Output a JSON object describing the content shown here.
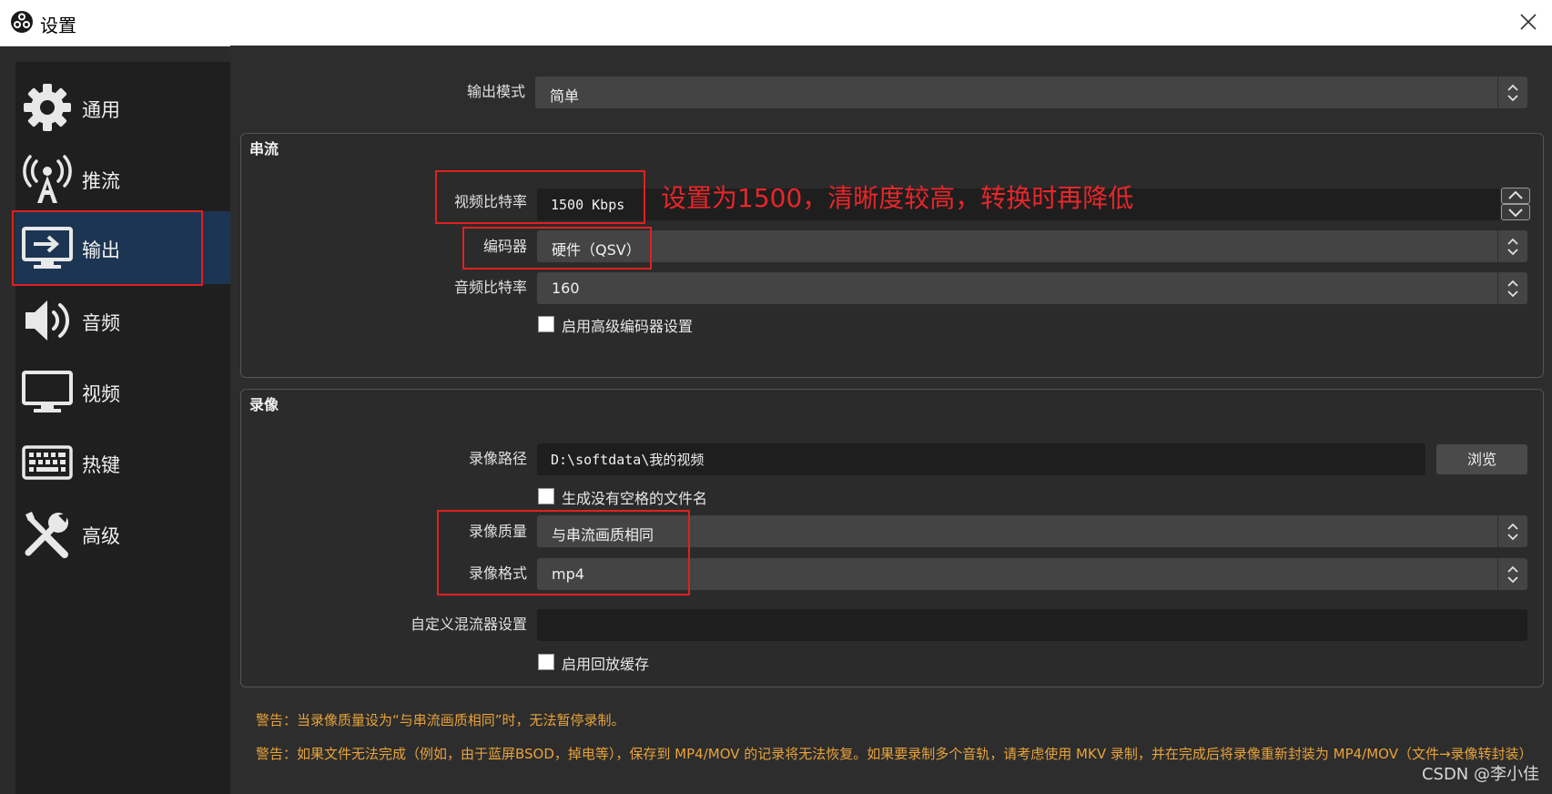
{
  "window": {
    "title": "设置"
  },
  "sidebar": {
    "items": [
      {
        "label": "通用",
        "icon": "gear-icon"
      },
      {
        "label": "推流",
        "icon": "broadcast-tower-icon"
      },
      {
        "label": "输出",
        "icon": "monitor-output-icon",
        "active": true
      },
      {
        "label": "音频",
        "icon": "speaker-icon"
      },
      {
        "label": "视频",
        "icon": "monitor-icon"
      },
      {
        "label": "热键",
        "icon": "keyboard-icon"
      },
      {
        "label": "高级",
        "icon": "tools-icon"
      }
    ]
  },
  "output_mode": {
    "label": "输出模式",
    "value": "简单"
  },
  "streaming": {
    "title": "串流",
    "video_bitrate_label": "视频比特率",
    "video_bitrate_value": "1500 Kbps",
    "encoder_label": "编码器",
    "encoder_value": "硬件（QSV）",
    "audio_bitrate_label": "音频比特率",
    "audio_bitrate_value": "160",
    "advanced_encoder_label": "启用高级编码器设置"
  },
  "annotation": "设置为1500，清晰度较高，转换时再降低",
  "recording": {
    "title": "录像",
    "path_label": "录像路径",
    "path_value": "D:\\softdata\\我的视频",
    "browse_label": "浏览",
    "no_space_label": "生成没有空格的文件名",
    "quality_label": "录像质量",
    "quality_value": "与串流画质相同",
    "format_label": "录像格式",
    "format_value": "mp4",
    "muxer_label": "自定义混流器设置",
    "muxer_value": "",
    "replay_buffer_label": "启用回放缓存"
  },
  "warnings": [
    "警告：当录像质量设为“与串流画质相同”时，无法暂停录制。",
    "警告：如果文件无法完成（例如，由于蓝屏BSOD，掉电等），保存到 MP4/MOV 的记录将无法恢复。如果要录制多个音轨，请考虑使用 MKV 录制，并在完成后将录像重新封装为 MP4/MOV（文件→录像转封装）"
  ],
  "watermark": "CSDN @李小佳",
  "colors": {
    "annotation_red": "#e8262a",
    "warning_orange": "#e8a33a",
    "active_item": "#1c3553"
  }
}
